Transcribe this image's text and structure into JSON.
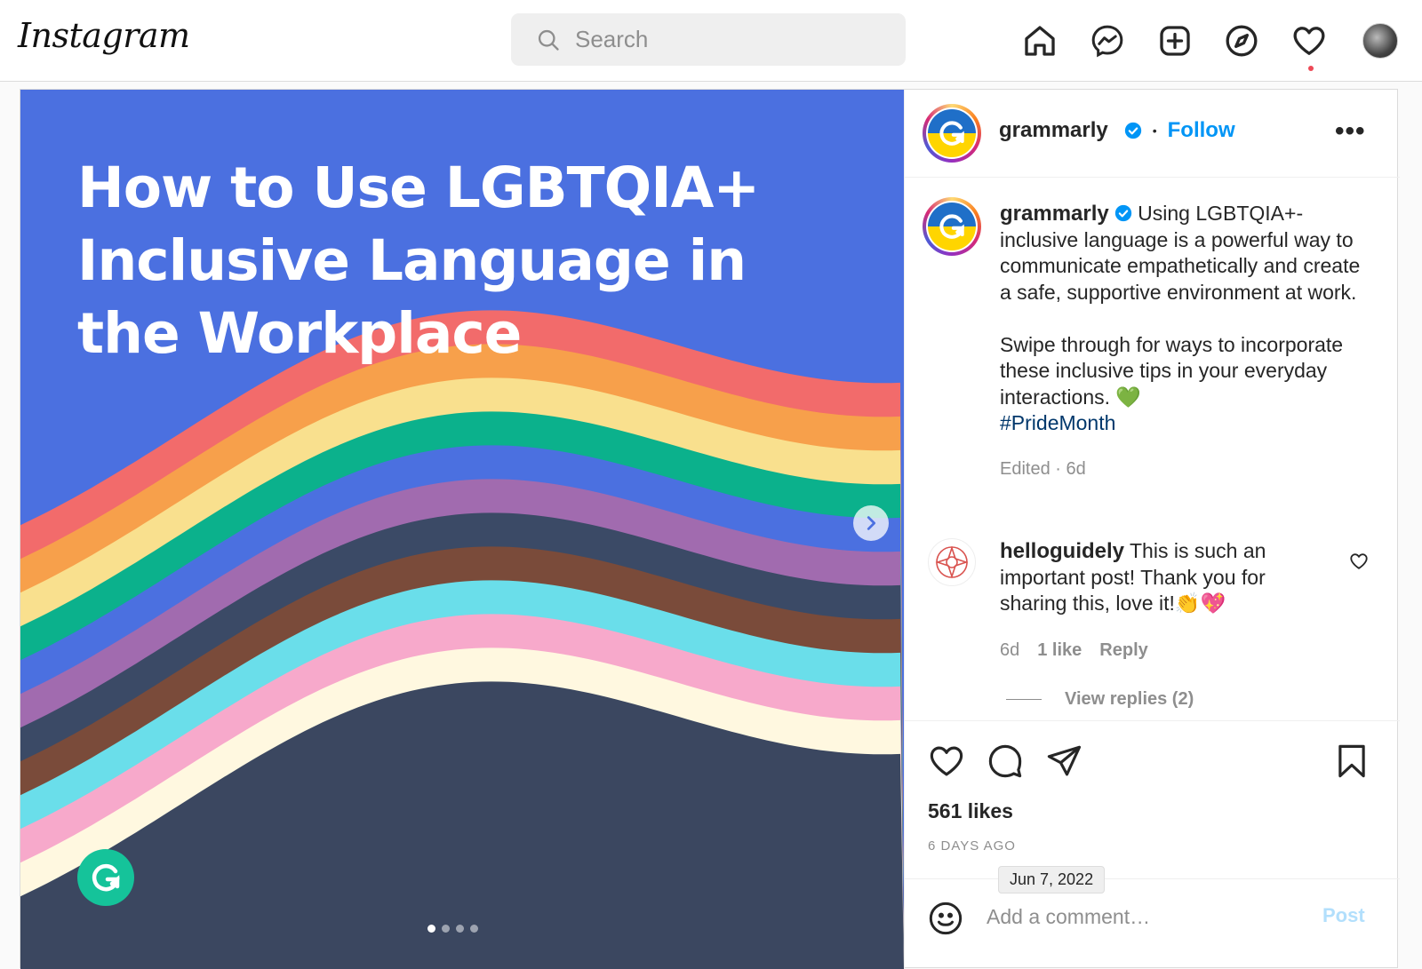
{
  "header": {
    "logo": "Instagram",
    "search_placeholder": "Search",
    "nav_icons": [
      "home-icon",
      "messenger-icon",
      "new-post-icon",
      "explore-icon",
      "activity-heart-icon",
      "profile-avatar"
    ]
  },
  "media": {
    "title_line1": "How to Use LGBTQIA+",
    "title_line2": "Inclusive Language in",
    "title_line3": "the Workplace",
    "background_color": "#4b70e0",
    "stripe_colors": [
      "#f26b6b",
      "#f7a04b",
      "#f9e08e",
      "#0bb18c",
      "#4b70e0",
      "#a16baf",
      "#3b4a66",
      "#7a4b3a",
      "#6adeea",
      "#f7a9cb",
      "#fff8e0",
      "#3b4760"
    ],
    "carousel_dots": 4,
    "active_dot": 0
  },
  "post_header": {
    "username": "grammarly",
    "follow_label": "Follow",
    "separator": "•",
    "more_label": "•••"
  },
  "caption": {
    "username": "grammarly",
    "text_p1": "Using LGBTQIA+-inclusive language is a powerful way to communicate empathetically and create a safe, supportive environment at work.",
    "text_p2": "Swipe through for ways to incorporate these inclusive tips in your everyday interactions. 💚",
    "hashtag": "#PrideMonth",
    "meta": "Edited · 6d"
  },
  "comment": {
    "username": "helloguidely",
    "text": "This is such an important post! Thank you for sharing this, love it!👏💖",
    "time": "6d",
    "likes": "1 like",
    "reply": "Reply",
    "view_replies": "View replies (2)"
  },
  "engagement": {
    "likes": "561 likes",
    "ago": "6 DAYS AGO",
    "tooltip_date": "Jun 7, 2022"
  },
  "add_comment": {
    "placeholder": "Add a comment…",
    "post_label": "Post"
  },
  "colors": {
    "accent_blue": "#0095f6",
    "hashtag": "#00376b",
    "notification_red": "#ed4956",
    "grammarly_green": "#15c39a"
  }
}
